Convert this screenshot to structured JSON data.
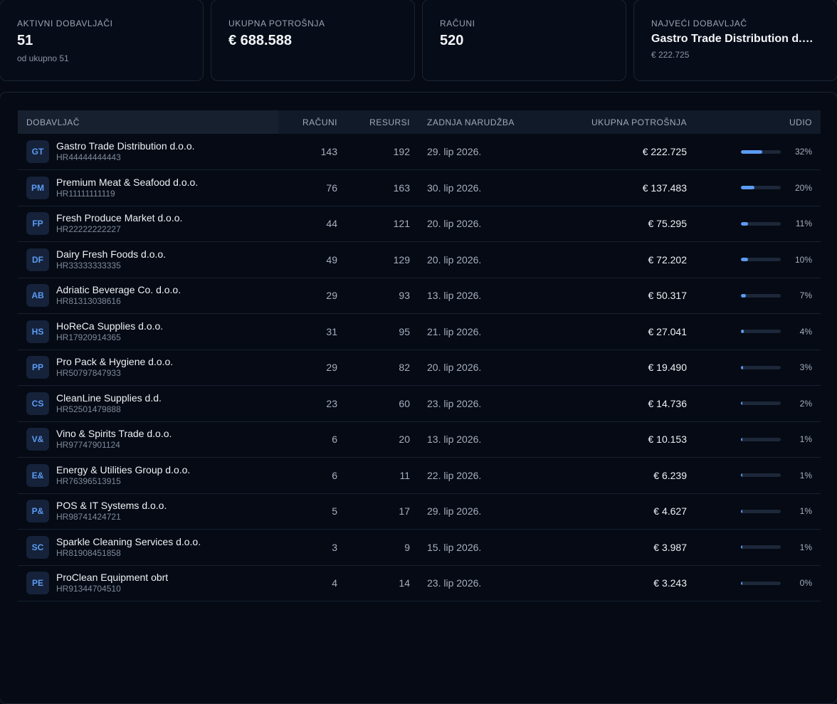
{
  "colors": {
    "accent": "#5b9bf2",
    "background": "#050a14"
  },
  "stats": [
    {
      "label": "AKTIVNI DOBAVLJAČI",
      "value": "51",
      "sub": "od ukupno 51"
    },
    {
      "label": "UKUPNA POTROŠNJA",
      "value": "€ 688.588",
      "sub": ""
    },
    {
      "label": "RAČUNI",
      "value": "520",
      "sub": ""
    },
    {
      "label": "NAJVEĆI DOBAVLJAČ",
      "value": "Gastro Trade Distribution d.o.o.",
      "sub": "€ 222.725"
    }
  ],
  "table": {
    "headers": {
      "supplier": "DOBAVLJAČ",
      "invoices": "RAČUNI",
      "resources": "RESURSI",
      "last_order": "ZADNJA NARUDŽBA",
      "total_spend": "UKUPNA POTROŠNJA",
      "share": "UDIO"
    },
    "rows": [
      {
        "initials": "GT",
        "name": "Gastro Trade Distribution d.o.o.",
        "vat": "HR44444444443",
        "invoices": "143",
        "resources": "192",
        "last_order": "29. lip 2026.",
        "spend": "€ 222.725",
        "share": "32%",
        "share_value": 0.32
      },
      {
        "initials": "PM",
        "name": "Premium Meat & Seafood d.o.o.",
        "vat": "HR11111111119",
        "invoices": "76",
        "resources": "163",
        "last_order": "30. lip 2026.",
        "spend": "€ 137.483",
        "share": "20%",
        "share_value": 0.2
      },
      {
        "initials": "FP",
        "name": "Fresh Produce Market d.o.o.",
        "vat": "HR22222222227",
        "invoices": "44",
        "resources": "121",
        "last_order": "20. lip 2026.",
        "spend": "€ 75.295",
        "share": "11%",
        "share_value": 0.11
      },
      {
        "initials": "DF",
        "name": "Dairy Fresh Foods d.o.o.",
        "vat": "HR33333333335",
        "invoices": "49",
        "resources": "129",
        "last_order": "20. lip 2026.",
        "spend": "€ 72.202",
        "share": "10%",
        "share_value": 0.1
      },
      {
        "initials": "AB",
        "name": "Adriatic Beverage Co. d.o.o.",
        "vat": "HR81313038616",
        "invoices": "29",
        "resources": "93",
        "last_order": "13. lip 2026.",
        "spend": "€ 50.317",
        "share": "7%",
        "share_value": 0.07
      },
      {
        "initials": "HS",
        "name": "HoReCa Supplies d.o.o.",
        "vat": "HR17920914365",
        "invoices": "31",
        "resources": "95",
        "last_order": "21. lip 2026.",
        "spend": "€ 27.041",
        "share": "4%",
        "share_value": 0.04
      },
      {
        "initials": "PP",
        "name": "Pro Pack & Hygiene d.o.o.",
        "vat": "HR50797847933",
        "invoices": "29",
        "resources": "82",
        "last_order": "20. lip 2026.",
        "spend": "€ 19.490",
        "share": "3%",
        "share_value": 0.03
      },
      {
        "initials": "CS",
        "name": "CleanLine Supplies d.d.",
        "vat": "HR52501479888",
        "invoices": "23",
        "resources": "60",
        "last_order": "23. lip 2026.",
        "spend": "€ 14.736",
        "share": "2%",
        "share_value": 0.02
      },
      {
        "initials": "V&",
        "name": "Vino & Spirits Trade d.o.o.",
        "vat": "HR97747901124",
        "invoices": "6",
        "resources": "20",
        "last_order": "13. lip 2026.",
        "spend": "€ 10.153",
        "share": "1%",
        "share_value": 0.015
      },
      {
        "initials": "E&",
        "name": "Energy & Utilities Group d.o.o.",
        "vat": "HR76396513915",
        "invoices": "6",
        "resources": "11",
        "last_order": "22. lip 2026.",
        "spend": "€ 6.239",
        "share": "1%",
        "share_value": 0.009
      },
      {
        "initials": "P&",
        "name": "POS & IT Systems d.o.o.",
        "vat": "HR98741424721",
        "invoices": "5",
        "resources": "17",
        "last_order": "29. lip 2026.",
        "spend": "€ 4.627",
        "share": "1%",
        "share_value": 0.007
      },
      {
        "initials": "SC",
        "name": "Sparkle Cleaning Services d.o.o.",
        "vat": "HR81908451858",
        "invoices": "3",
        "resources": "9",
        "last_order": "15. lip 2026.",
        "spend": "€ 3.987",
        "share": "1%",
        "share_value": 0.006
      },
      {
        "initials": "PE",
        "name": "ProClean Equipment obrt",
        "vat": "HR91344704510",
        "invoices": "4",
        "resources": "14",
        "last_order": "23. lip 2026.",
        "spend": "€ 3.243",
        "share": "0%",
        "share_value": 0.005
      }
    ]
  }
}
